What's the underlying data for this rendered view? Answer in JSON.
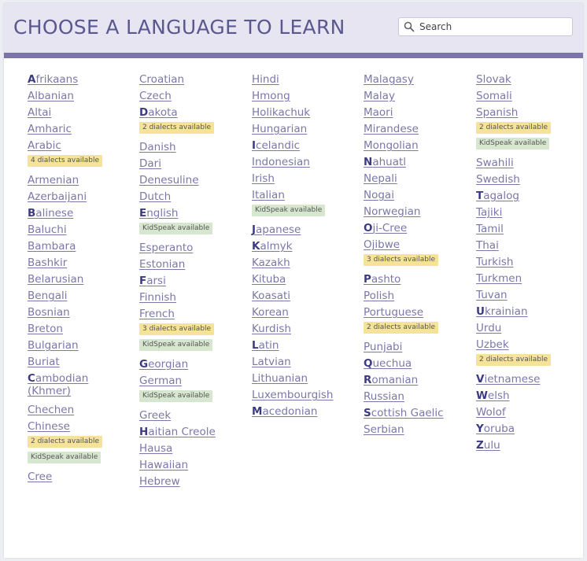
{
  "header": {
    "title": "CHOOSE A LANGUAGE TO LEARN",
    "search_placeholder": "Search"
  },
  "columns": [
    [
      {
        "name": "Afrikaans",
        "bold": true
      },
      {
        "name": "Albanian"
      },
      {
        "name": "Altai"
      },
      {
        "name": "Amharic"
      },
      {
        "name": "Arabic",
        "badges": [
          "4 dialects available"
        ]
      },
      {
        "name": "Armenian"
      },
      {
        "name": "Azerbaijani"
      },
      {
        "name": "Balinese",
        "bold": true
      },
      {
        "name": "Baluchi"
      },
      {
        "name": "Bambara"
      },
      {
        "name": "Bashkir"
      },
      {
        "name": "Belarusian"
      },
      {
        "name": "Bengali"
      },
      {
        "name": "Bosnian"
      },
      {
        "name": "Breton"
      },
      {
        "name": "Bulgarian"
      },
      {
        "name": "Buriat"
      },
      {
        "name": "Cambodian (Khmer)",
        "bold": true,
        "multi": true
      },
      {
        "name": "Chechen"
      },
      {
        "name": "Chinese",
        "badges": [
          "2 dialects available",
          "KidSpeak available"
        ]
      },
      {
        "name": "Cree"
      }
    ],
    [
      {
        "name": "Croatian"
      },
      {
        "name": "Czech"
      },
      {
        "name": "Dakota",
        "bold": true,
        "badges": [
          "2 dialects available"
        ]
      },
      {
        "name": "Danish"
      },
      {
        "name": "Dari"
      },
      {
        "name": "Denesuline"
      },
      {
        "name": "Dutch"
      },
      {
        "name": "English",
        "bold": true,
        "badges": [
          "KidSpeak available"
        ]
      },
      {
        "name": "Esperanto"
      },
      {
        "name": "Estonian"
      },
      {
        "name": "Farsi",
        "bold": true
      },
      {
        "name": "Finnish"
      },
      {
        "name": "French",
        "badges": [
          "3 dialects available",
          "KidSpeak available"
        ]
      },
      {
        "name": "Georgian",
        "bold": true
      },
      {
        "name": "German",
        "badges": [
          "KidSpeak available"
        ]
      },
      {
        "name": "Greek"
      },
      {
        "name": "Haitian Creole",
        "bold": true
      },
      {
        "name": "Hausa"
      },
      {
        "name": "Hawaiian"
      },
      {
        "name": "Hebrew"
      }
    ],
    [
      {
        "name": "Hindi"
      },
      {
        "name": "Hmong"
      },
      {
        "name": "Holikachuk"
      },
      {
        "name": "Hungarian"
      },
      {
        "name": "Icelandic",
        "bold": true
      },
      {
        "name": "Indonesian"
      },
      {
        "name": "Irish"
      },
      {
        "name": "Italian",
        "badges": [
          "KidSpeak available"
        ]
      },
      {
        "name": "Japanese",
        "bold": true
      },
      {
        "name": "Kalmyk",
        "bold": true
      },
      {
        "name": "Kazakh"
      },
      {
        "name": "Kituba"
      },
      {
        "name": "Koasati"
      },
      {
        "name": "Korean"
      },
      {
        "name": "Kurdish"
      },
      {
        "name": "Latin",
        "bold": true
      },
      {
        "name": "Latvian"
      },
      {
        "name": "Lithuanian"
      },
      {
        "name": "Luxembourgish"
      },
      {
        "name": "Macedonian",
        "bold": true
      }
    ],
    [
      {
        "name": "Malagasy"
      },
      {
        "name": "Malay"
      },
      {
        "name": "Maori"
      },
      {
        "name": "Mirandese"
      },
      {
        "name": "Mongolian"
      },
      {
        "name": "Nahuatl",
        "bold": true
      },
      {
        "name": "Nepali"
      },
      {
        "name": "Nogai"
      },
      {
        "name": "Norwegian"
      },
      {
        "name": "Oji-Cree",
        "bold": true
      },
      {
        "name": "Ojibwe",
        "badges": [
          "3 dialects available"
        ]
      },
      {
        "name": "Pashto",
        "bold": true
      },
      {
        "name": "Polish"
      },
      {
        "name": "Portuguese",
        "badges": [
          "2 dialects available"
        ]
      },
      {
        "name": "Punjabi"
      },
      {
        "name": "Quechua",
        "bold": true
      },
      {
        "name": "Romanian",
        "bold": true
      },
      {
        "name": "Russian"
      },
      {
        "name": "Scottish Gaelic",
        "bold": true
      },
      {
        "name": "Serbian"
      }
    ],
    [
      {
        "name": "Slovak"
      },
      {
        "name": "Somali"
      },
      {
        "name": "Spanish",
        "badges": [
          "2 dialects available",
          "KidSpeak available"
        ]
      },
      {
        "name": "Swahili"
      },
      {
        "name": "Swedish"
      },
      {
        "name": "Tagalog",
        "bold": true
      },
      {
        "name": "Tajiki"
      },
      {
        "name": "Tamil"
      },
      {
        "name": "Thai"
      },
      {
        "name": "Turkish"
      },
      {
        "name": "Turkmen"
      },
      {
        "name": "Tuvan"
      },
      {
        "name": "Ukrainian",
        "bold": true
      },
      {
        "name": "Urdu"
      },
      {
        "name": "Uzbek",
        "badges": [
          "2 dialects available"
        ]
      },
      {
        "name": "Vietnamese",
        "bold": true
      },
      {
        "name": "Welsh",
        "bold": true
      },
      {
        "name": "Wolof"
      },
      {
        "name": "Yoruba",
        "bold": true
      },
      {
        "name": "Zulu",
        "bold": true
      }
    ]
  ],
  "colors": {
    "header_bg": "#e6e5f1",
    "accent_bar": "#7c75a8",
    "link": "#7b77a8",
    "first_letter": "#3c3a80",
    "dialect_badge": "#f5e39a",
    "kidspeak_badge": "#d6e6cf"
  }
}
